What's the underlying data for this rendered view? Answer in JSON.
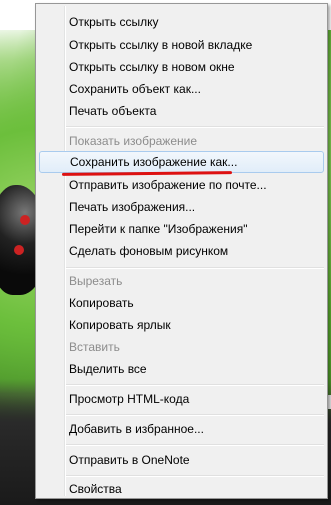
{
  "menu": {
    "items": [
      {
        "label": "Открыть ссылку",
        "enabled": true
      },
      {
        "label": "Открыть ссылку в новой вкладке",
        "enabled": true
      },
      {
        "label": "Открыть ссылку в новом окне",
        "enabled": true
      },
      {
        "label": "Сохранить объект как...",
        "enabled": true
      },
      {
        "label": "Печать объекта",
        "enabled": true
      },
      {
        "label": "Показать изображение",
        "enabled": false
      },
      {
        "label": "Сохранить изображение как...",
        "enabled": true,
        "highlighted": true
      },
      {
        "label": "Отправить изображение по почте...",
        "enabled": true
      },
      {
        "label": "Печать изображения...",
        "enabled": true
      },
      {
        "label": "Перейти к папке \"Изображения\"",
        "enabled": true
      },
      {
        "label": "Сделать фоновым рисунком",
        "enabled": true
      },
      {
        "label": "Вырезать",
        "enabled": false
      },
      {
        "label": "Копировать",
        "enabled": true
      },
      {
        "label": "Копировать ярлык",
        "enabled": true
      },
      {
        "label": "Вставить",
        "enabled": false
      },
      {
        "label": "Выделить все",
        "enabled": true
      },
      {
        "label": "Просмотр HTML-кода",
        "enabled": true
      },
      {
        "label": "Добавить в избранное...",
        "enabled": true
      },
      {
        "label": "Отправить в OneNote",
        "enabled": true
      },
      {
        "label": "Свойства",
        "enabled": true
      }
    ]
  },
  "colors": {
    "highlight_border": "#a9cbee",
    "disabled_text": "#8c8c8c",
    "annotation_underline": "#d11111"
  }
}
